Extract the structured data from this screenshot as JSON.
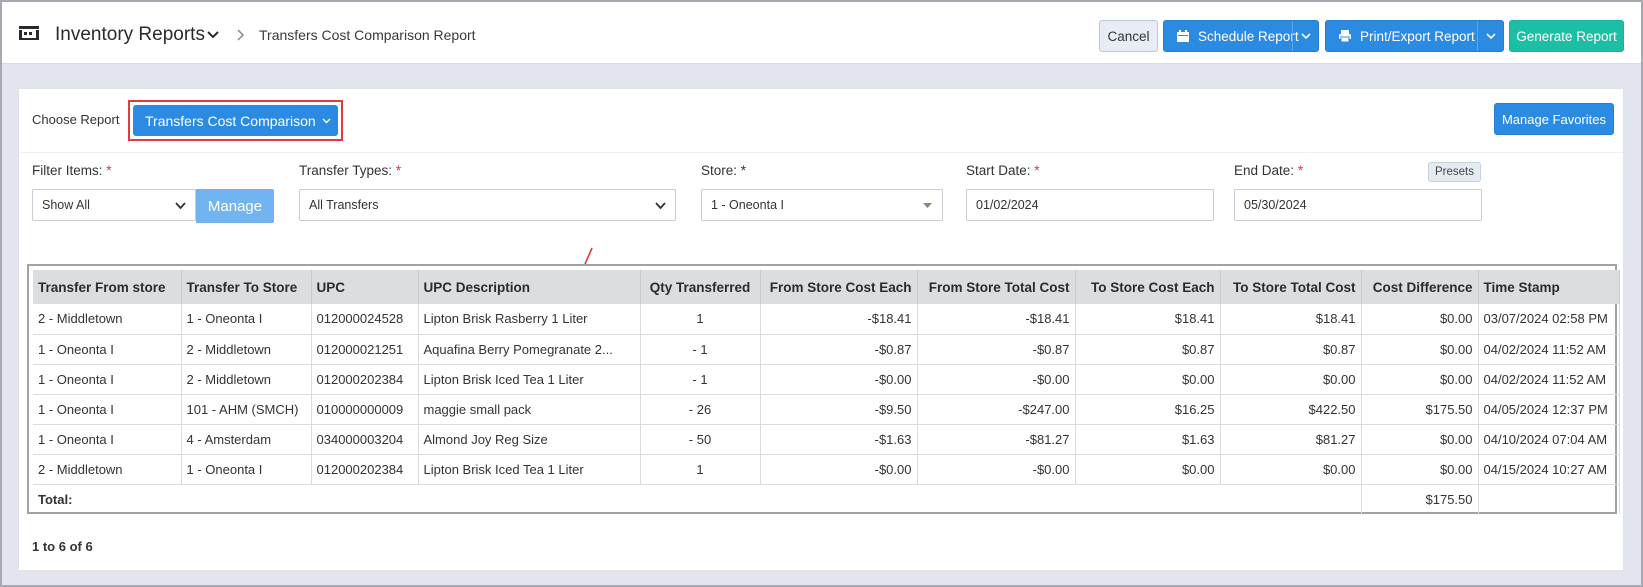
{
  "header": {
    "app_title": "Inventory Reports",
    "breadcrumb": "Transfers Cost Comparison Report",
    "buttons": {
      "cancel": "Cancel",
      "schedule": "Schedule Report",
      "print_export": "Print/Export Report",
      "generate": "Generate Report"
    }
  },
  "report_selector": {
    "label": "Choose Report",
    "selected": "Transfers Cost Comparison",
    "manage_favorites": "Manage Favorites"
  },
  "filters": {
    "filter_items": {
      "label": "Filter Items:",
      "value": "Show All",
      "manage_label": "Manage"
    },
    "transfer_types": {
      "label": "Transfer Types:",
      "value": "All Transfers"
    },
    "store": {
      "label": "Store: *",
      "value": "1 - Oneonta I"
    },
    "start_date": {
      "label": "Start Date:",
      "value": "01/02/2024"
    },
    "end_date": {
      "label": "End Date:",
      "value": "05/30/2024"
    },
    "presets_label": "Presets",
    "required_mark": "*"
  },
  "table": {
    "columns": [
      "Transfer From store",
      "Transfer To Store",
      "UPC",
      "UPC Description",
      "Qty Transferred",
      "From Store Cost Each",
      "From Store Total Cost",
      "To Store Cost Each",
      "To Store Total Cost",
      "Cost Difference",
      "Time Stamp"
    ],
    "rows": [
      [
        "2 - Middletown",
        "1 - Oneonta I",
        "012000024528",
        "Lipton Brisk Rasberry 1 Liter",
        "1",
        "-$18.41",
        "-$18.41",
        "$18.41",
        "$18.41",
        "$0.00",
        "03/07/2024 02:58 PM"
      ],
      [
        "1 - Oneonta I",
        "2 - Middletown",
        "012000021251",
        "Aquafina Berry Pomegranate 2...",
        "- 1",
        "-$0.87",
        "-$0.87",
        "$0.87",
        "$0.87",
        "$0.00",
        "04/02/2024 11:52 AM"
      ],
      [
        "1 - Oneonta I",
        "2 - Middletown",
        "012000202384",
        "Lipton Brisk Iced Tea 1 Liter",
        "- 1",
        "-$0.00",
        "-$0.00",
        "$0.00",
        "$0.00",
        "$0.00",
        "04/02/2024 11:52 AM"
      ],
      [
        "1 - Oneonta I",
        "101 - AHM (SMCH)",
        "010000000009",
        "maggie small pack",
        "- 26",
        "-$9.50",
        "-$247.00",
        "$16.25",
        "$422.50",
        "$175.50",
        "04/05/2024 12:37 PM"
      ],
      [
        "1 - Oneonta I",
        "4 - Amsterdam",
        "034000003204",
        "Almond Joy Reg Size",
        "- 50",
        "-$1.63",
        "-$81.27",
        "$1.63",
        "$81.27",
        "$0.00",
        "04/10/2024 07:04 AM"
      ],
      [
        "2 - Middletown",
        "1 - Oneonta I",
        "012000202384",
        "Lipton Brisk Iced Tea 1 Liter",
        "1",
        "-$0.00",
        "-$0.00",
        "$0.00",
        "$0.00",
        "$0.00",
        "04/15/2024 10:27 AM"
      ]
    ],
    "total_label": "Total:",
    "total_cost_difference": "$175.50"
  },
  "pager": "1 to 6 of 6",
  "colors": {
    "primary": "#2b8be3",
    "success": "#1dbfa4",
    "highlight": "#e23b3b"
  }
}
